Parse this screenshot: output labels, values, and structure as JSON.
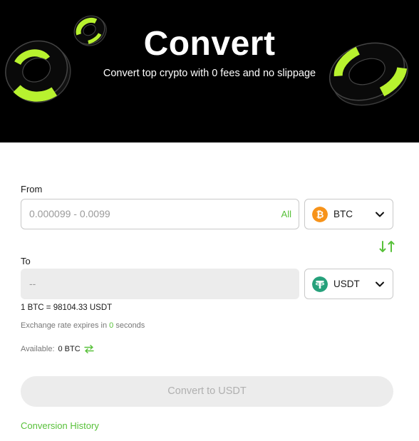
{
  "hero": {
    "title": "Convert",
    "subtitle": "Convert top crypto with 0 fees and no slippage"
  },
  "from": {
    "label": "From",
    "placeholder": "0.000099 - 0.0099",
    "all_label": "All",
    "coin": "BTC",
    "coin_icon": "bitcoin-icon",
    "coin_color": "#f7931a"
  },
  "to": {
    "label": "To",
    "placeholder": "--",
    "coin": "USDT",
    "coin_icon": "tether-icon",
    "coin_color": "#26a17b"
  },
  "rate_text": "1 BTC = 98104.33 USDT",
  "expire": {
    "prefix": "Exchange rate expires in",
    "seconds": "0",
    "suffix": "seconds"
  },
  "available": {
    "label": "Available:",
    "amount": "0 BTC"
  },
  "convert_button": "Convert to USDT",
  "history_link": "Conversion History",
  "colors": {
    "accent": "#58c13a",
    "hero_bg": "#000000",
    "disabled_bg": "#ececec"
  }
}
